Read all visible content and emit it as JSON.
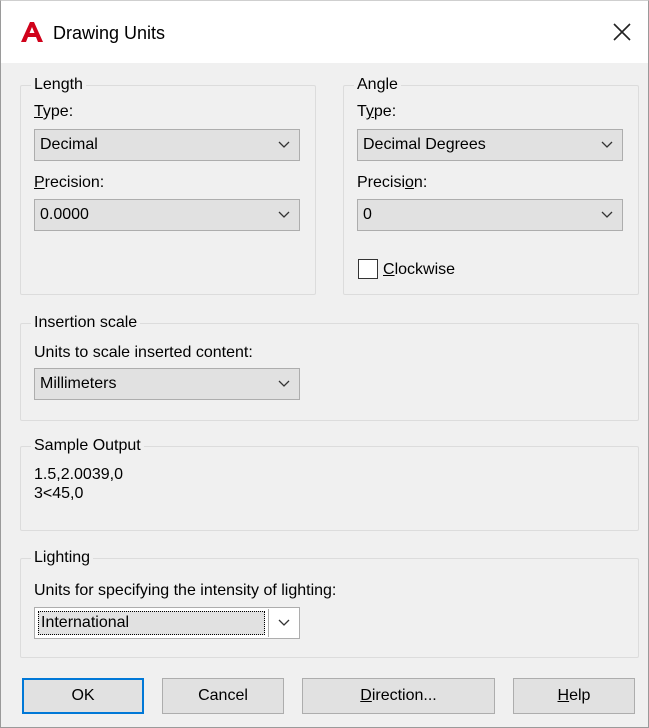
{
  "window": {
    "title": "Drawing Units",
    "app_icon": "autocad-a-icon",
    "close_glyph": "✕"
  },
  "length": {
    "legend": "Length",
    "type_label": "Type:",
    "type_value": "Decimal",
    "precision_label": "Precision:",
    "precision_value": "0.0000"
  },
  "angle": {
    "legend": "Angle",
    "type_label": "Type:",
    "type_value": "Decimal Degrees",
    "precision_label": "Precision:",
    "precision_value": "0",
    "clockwise_label": "Clockwise",
    "clockwise_checked": false
  },
  "insertion": {
    "legend": "Insertion scale",
    "units_label": "Units to scale inserted content:",
    "units_value": "Millimeters"
  },
  "sample": {
    "legend": "Sample Output",
    "line1": "1.5,2.0039,0",
    "line2": "3<45,0"
  },
  "lighting": {
    "legend": "Lighting",
    "units_label": "Units for specifying the intensity of lighting:",
    "units_value": "International"
  },
  "buttons": {
    "ok": "OK",
    "cancel": "Cancel",
    "direction": "Direction...",
    "help": "Help"
  },
  "colors": {
    "accent": "#0078d7",
    "app_icon": "#d0021b",
    "dialog_bg": "#f0f0f0"
  }
}
